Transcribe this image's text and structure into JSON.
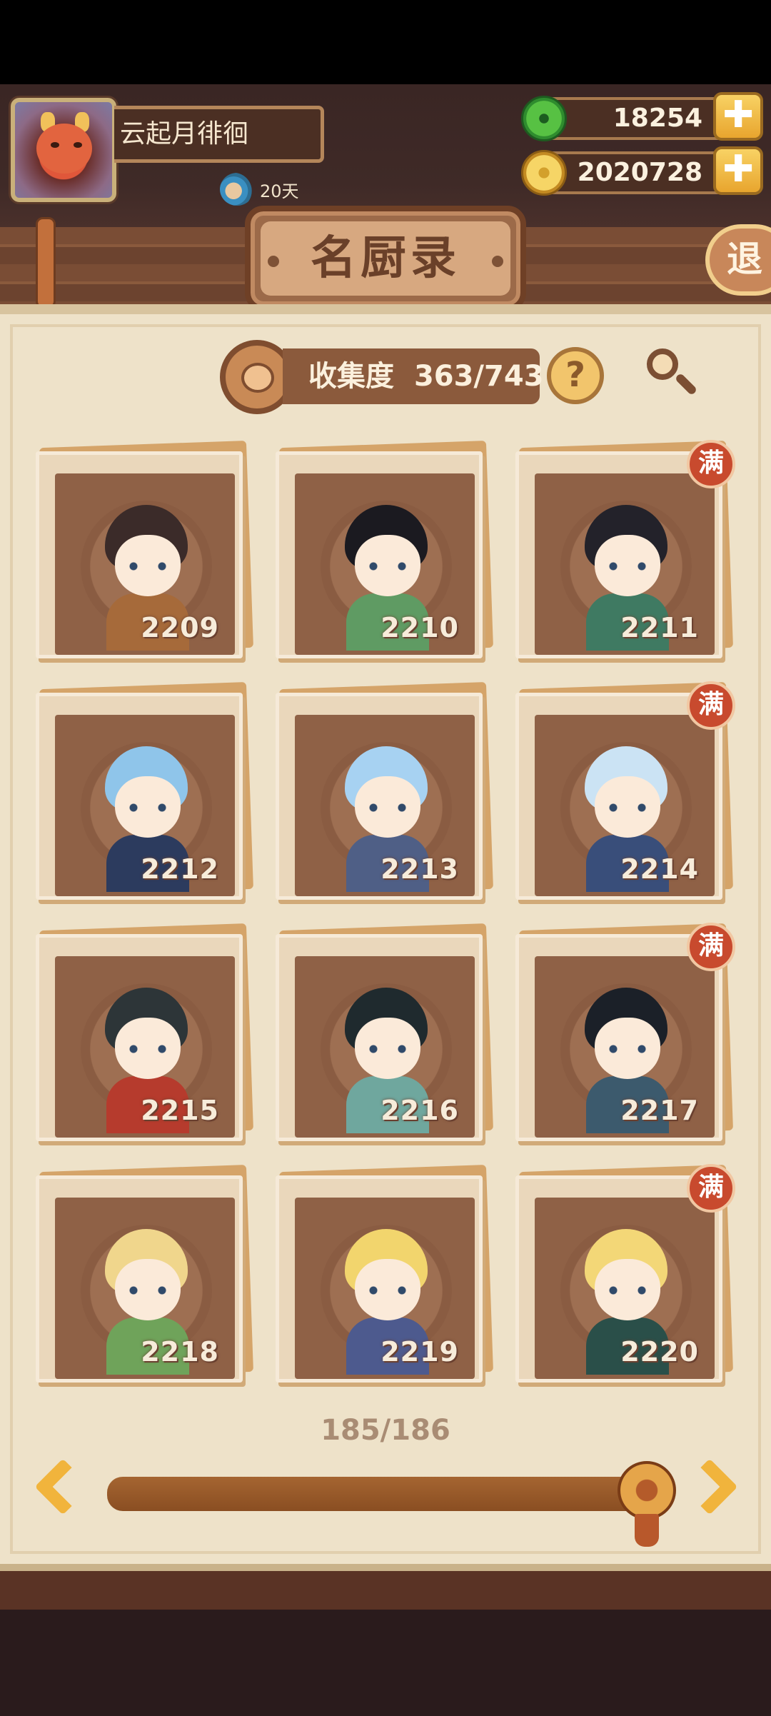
{
  "player": {
    "name": "云起月徘徊",
    "days": "20天"
  },
  "currency": {
    "jade": "18254",
    "coins": "2020728",
    "add_label": "✚"
  },
  "header": {
    "title": "名厨录",
    "exit_label": "退"
  },
  "collection": {
    "label": "收集度",
    "progress": "363/743",
    "help_label": "?"
  },
  "cards": [
    {
      "number": "2209",
      "full": false,
      "hair": "#3b2b29",
      "body": "#a66a3a"
    },
    {
      "number": "2210",
      "full": false,
      "hair": "#1b1a20",
      "body": "#5f9b63"
    },
    {
      "number": "2211",
      "full": true,
      "badge": "满",
      "hair": "#23222a",
      "body": "#3f7a62"
    },
    {
      "number": "2212",
      "full": false,
      "hair": "#8fc5ea",
      "body": "#2c3b5e"
    },
    {
      "number": "2213",
      "full": false,
      "hair": "#a7d2f2",
      "body": "#4f5f86"
    },
    {
      "number": "2214",
      "full": true,
      "badge": "满",
      "hair": "#cbe3f4",
      "body": "#394e7a"
    },
    {
      "number": "2215",
      "full": false,
      "hair": "#2d3538",
      "body": "#b63b2d"
    },
    {
      "number": "2216",
      "full": false,
      "hair": "#1f2a2e",
      "body": "#6fa79e"
    },
    {
      "number": "2217",
      "full": true,
      "badge": "满",
      "hair": "#1b2028",
      "body": "#3c5a6d"
    },
    {
      "number": "2218",
      "full": false,
      "hair": "#f0d68c",
      "body": "#6fa35a"
    },
    {
      "number": "2219",
      "full": false,
      "hair": "#f2d56d",
      "body": "#4d5a8e"
    },
    {
      "number": "2220",
      "full": true,
      "badge": "满",
      "hair": "#f3d777",
      "body": "#2a4f49"
    }
  ],
  "pagination": {
    "page": "185/186",
    "progress_fraction": 0.995
  },
  "colors": {
    "panel": "#eee2c9",
    "card_inner": "#8f6146",
    "full_badge": "#c84a2e",
    "accent": "#f1b43c"
  }
}
